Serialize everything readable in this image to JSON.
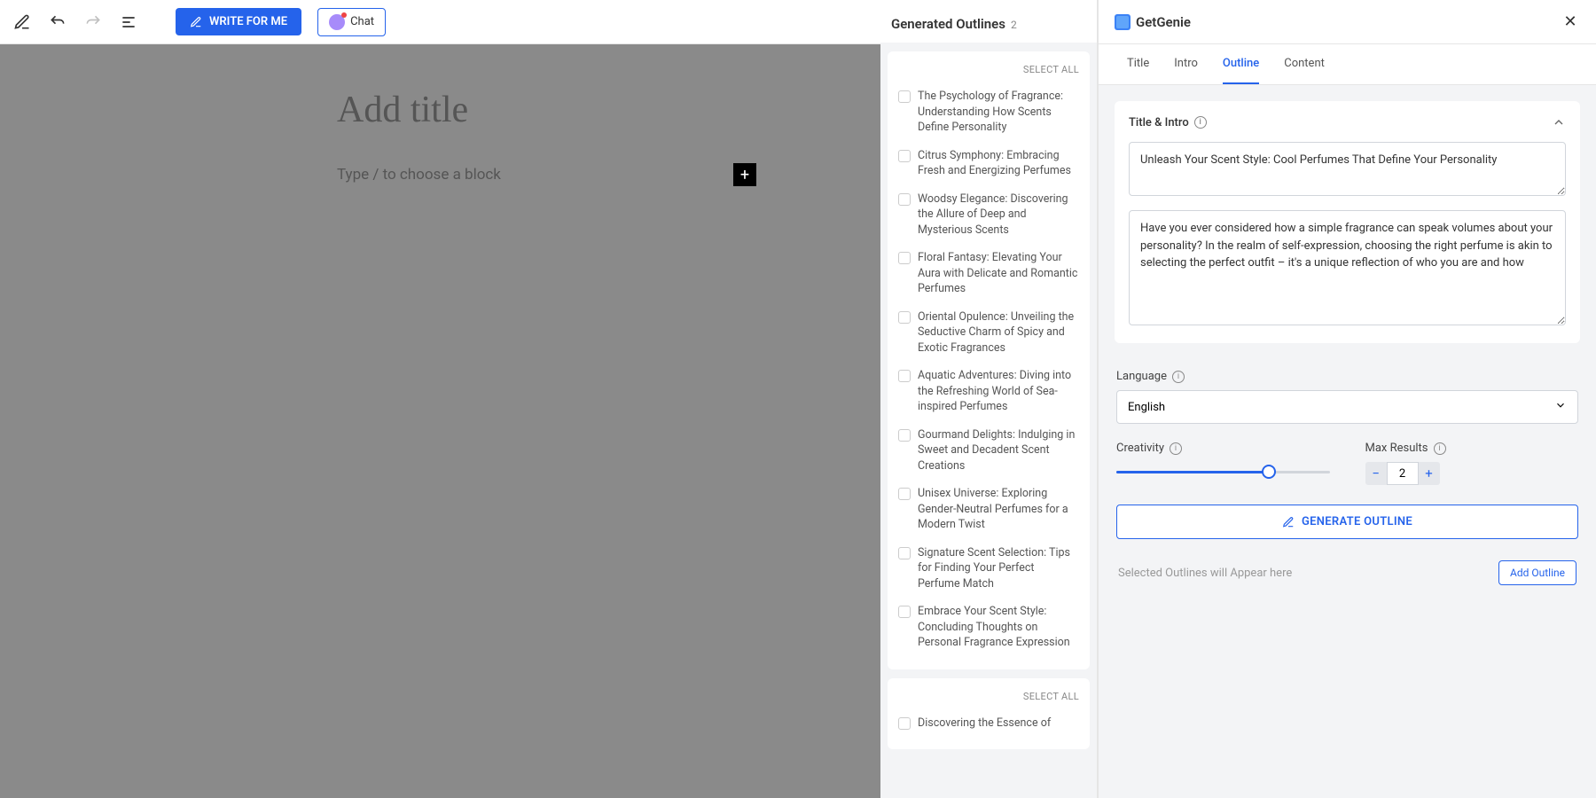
{
  "toolbar": {
    "write_btn": "WRITE FOR ME",
    "chat_btn": "Chat"
  },
  "editor": {
    "title_placeholder": "Add title",
    "block_placeholder": "Type / to choose a block"
  },
  "outlines": {
    "header": "Generated Outlines",
    "count": "2",
    "select_all": "SELECT ALL",
    "items": [
      "The Psychology of Fragrance: Understanding How Scents Define Personality",
      "Citrus Symphony: Embracing Fresh and Energizing Perfumes",
      "Woodsy Elegance: Discovering the Allure of Deep and Mysterious Scents",
      "Floral Fantasy: Elevating Your Aura with Delicate and Romantic Perfumes",
      "Oriental Opulence: Unveiling the Seductive Charm of Spicy and Exotic Fragrances",
      "Aquatic Adventures: Diving into the Refreshing World of Sea-inspired Perfumes",
      "Gourmand Delights: Indulging in Sweet and Decadent Scent Creations",
      "Unisex Universe: Exploring Gender-Neutral Perfumes for a Modern Twist",
      "Signature Scent Selection: Tips for Finding Your Perfect Perfume Match",
      "Embrace Your Scent Style: Concluding Thoughts on Personal Fragrance Expression"
    ],
    "second_card_first": "Discovering the Essence of"
  },
  "panel": {
    "brand": "GetGenie",
    "tabs": [
      "Title",
      "Intro",
      "Outline",
      "Content"
    ],
    "active_tab": 2,
    "title_intro_label": "Title & Intro",
    "title_value": "Unleash Your Scent Style: Cool Perfumes That Define Your Personality",
    "intro_value": "Have you ever considered how a simple fragrance can speak volumes about your personality? In the realm of self-expression, choosing the right perfume is akin to selecting the perfect outfit – it's a unique reflection of who you are and how",
    "language_label": "Language",
    "language_value": "English",
    "creativity_label": "Creativity",
    "max_results_label": "Max Results",
    "max_results_value": "2",
    "generate_btn": "GENERATE OUTLINE",
    "selected_placeholder": "Selected Outlines will Appear here",
    "add_outline_btn": "Add Outline"
  }
}
